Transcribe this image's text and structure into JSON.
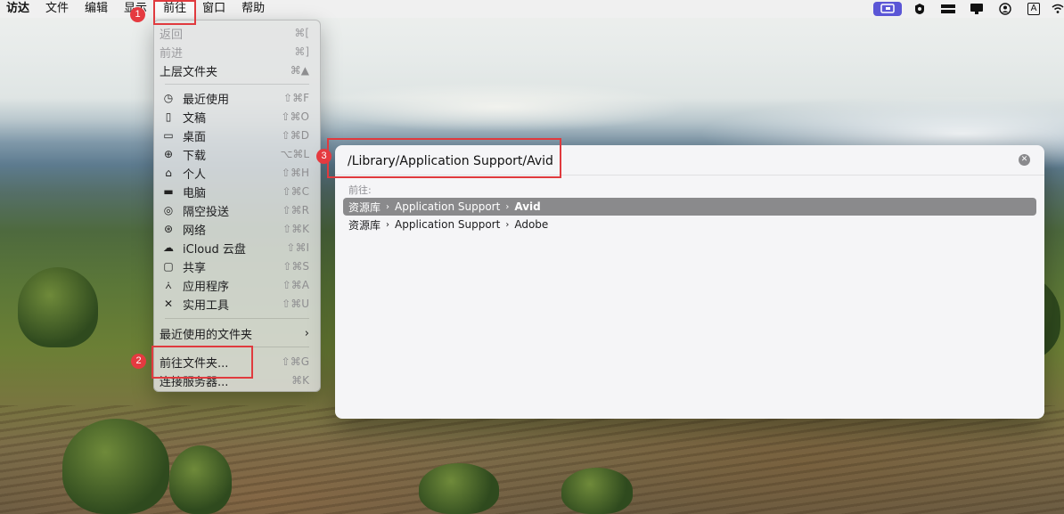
{
  "menubar": {
    "app": "访达",
    "items": [
      "文件",
      "编辑",
      "显示",
      "前往",
      "窗口",
      "帮助"
    ],
    "active": "前往",
    "status_icons": [
      "screen-mirroring-icon",
      "shield-icon",
      "dock-icon",
      "display-icon",
      "user-icon",
      "input-source-icon",
      "wifi-icon"
    ],
    "input_source_label": "A"
  },
  "go_menu": {
    "top_items": [
      {
        "label": "返回",
        "shortcut": "⌘[",
        "disabled": true
      },
      {
        "label": "前进",
        "shortcut": "⌘]",
        "disabled": true
      },
      {
        "label": "上层文件夹",
        "shortcut": "⌘▲",
        "disabled": false
      }
    ],
    "places": [
      {
        "label": "最近使用",
        "shortcut": "⇧⌘F",
        "icon": "clock-icon",
        "glyph": "◷"
      },
      {
        "label": "文稿",
        "shortcut": "⇧⌘O",
        "icon": "document-icon",
        "glyph": "▯"
      },
      {
        "label": "桌面",
        "shortcut": "⇧⌘D",
        "icon": "desktop-icon",
        "glyph": "▭"
      },
      {
        "label": "下载",
        "shortcut": "⌥⌘L",
        "icon": "download-icon",
        "glyph": "⊕"
      },
      {
        "label": "个人",
        "shortcut": "⇧⌘H",
        "icon": "home-icon",
        "glyph": "⌂"
      },
      {
        "label": "电脑",
        "shortcut": "⇧⌘C",
        "icon": "computer-icon",
        "glyph": "▬"
      },
      {
        "label": "隔空投送",
        "shortcut": "⇧⌘R",
        "icon": "airdrop-icon",
        "glyph": "◎"
      },
      {
        "label": "网络",
        "shortcut": "⇧⌘K",
        "icon": "network-icon",
        "glyph": "⊛"
      },
      {
        "label": "iCloud 云盘",
        "shortcut": "⇧⌘I",
        "icon": "cloud-icon",
        "glyph": "☁"
      },
      {
        "label": "共享",
        "shortcut": "⇧⌘S",
        "icon": "shared-folder-icon",
        "glyph": "▢"
      },
      {
        "label": "应用程序",
        "shortcut": "⇧⌘A",
        "icon": "applications-icon",
        "glyph": "⩑"
      },
      {
        "label": "实用工具",
        "shortcut": "⇧⌘U",
        "icon": "utilities-icon",
        "glyph": "✕"
      }
    ],
    "recent_folders": {
      "label": "最近使用的文件夹",
      "submenu_glyph": "›"
    },
    "go_to_folder": {
      "label": "前往文件夹...",
      "shortcut": "⇧⌘G"
    },
    "connect_server": {
      "label": "连接服务器...",
      "shortcut": "⌘K"
    }
  },
  "dialog": {
    "path_value": "/Library/Application Support/Avid",
    "goto_label": "前往:",
    "results": [
      {
        "parts": [
          "资源库",
          "Application Support"
        ],
        "last": "Avid",
        "selected": true
      },
      {
        "parts": [
          "资源库",
          "Application Support"
        ],
        "last": "Adobe",
        "selected": false
      }
    ],
    "chevron": "›",
    "clear_glyph": "✕"
  },
  "annotations": {
    "badge1": "1",
    "badge2": "2",
    "badge3": "3"
  },
  "colors": {
    "annotation_red": "#e03a3e",
    "selection_gray": "#8a8a8c",
    "status_highlight": "#5b56d6"
  }
}
